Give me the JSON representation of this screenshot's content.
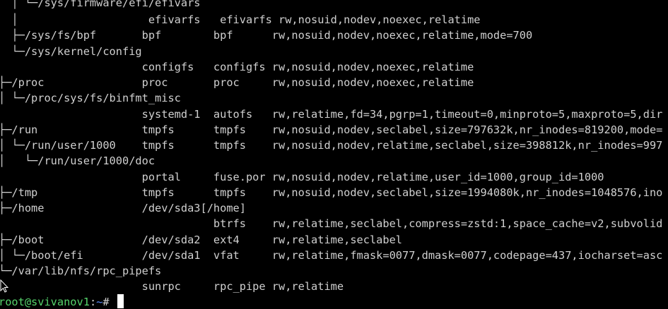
{
  "terminal": {
    "lines": [
      "  │ └─/sys/firmware/efi/efivars",
      "  │                    efivarfs   efivarfs rw,nosuid,nodev,noexec,relatime",
      "  ├─/sys/fs/bpf       bpf        bpf      rw,nosuid,nodev,noexec,relatime,mode=700",
      "  └─/sys/kernel/config",
      "                      configfs   configfs rw,nosuid,nodev,noexec,relatime",
      "├─/proc               proc       proc     rw,nosuid,nodev,noexec,relatime",
      "│ └─/proc/sys/fs/binfmt_misc",
      "                      systemd-1  autofs   rw,relatime,fd=34,pgrp=1,timeout=0,minproto=5,maxproto=5,dir",
      "├─/run                tmpfs      tmpfs    rw,nosuid,nodev,seclabel,size=797632k,nr_inodes=819200,mode=",
      "│ └─/run/user/1000    tmpfs      tmpfs    rw,nosuid,nodev,relatime,seclabel,size=398812k,nr_inodes=997",
      "│   └─/run/user/1000/doc",
      "                      portal     fuse.por rw,nosuid,nodev,relatime,user_id=1000,group_id=1000",
      "├─/tmp                tmpfs      tmpfs    rw,nosuid,nodev,seclabel,size=1994080k,nr_inodes=1048576,ino",
      "├─/home               /dev/sda3[/home]",
      "                                 btrfs    rw,relatime,seclabel,compress=zstd:1,space_cache=v2,subvolid",
      "├─/boot               /dev/sda2  ext4     rw,relatime,seclabel",
      "│ └─/boot/efi         /dev/sda1  vfat     rw,relatime,fmask=0077,dmask=0077,codepage=437,iocharset=asc",
      "└─/var/lib/nfs/rpc_pipefs",
      "                      sunrpc     rpc_pipe rw,relatime"
    ],
    "prompt": {
      "user_host": "root@svivanov1",
      "separator": ":",
      "path": "~",
      "symbol": "# "
    },
    "colors": {
      "background": "#000000",
      "foreground": "#d0d0d0",
      "prompt_user": "#55d36b",
      "prompt_path": "#5f8fff",
      "cursor": "#ffffff"
    },
    "pointer_icon": "mouse-pointer-icon"
  }
}
